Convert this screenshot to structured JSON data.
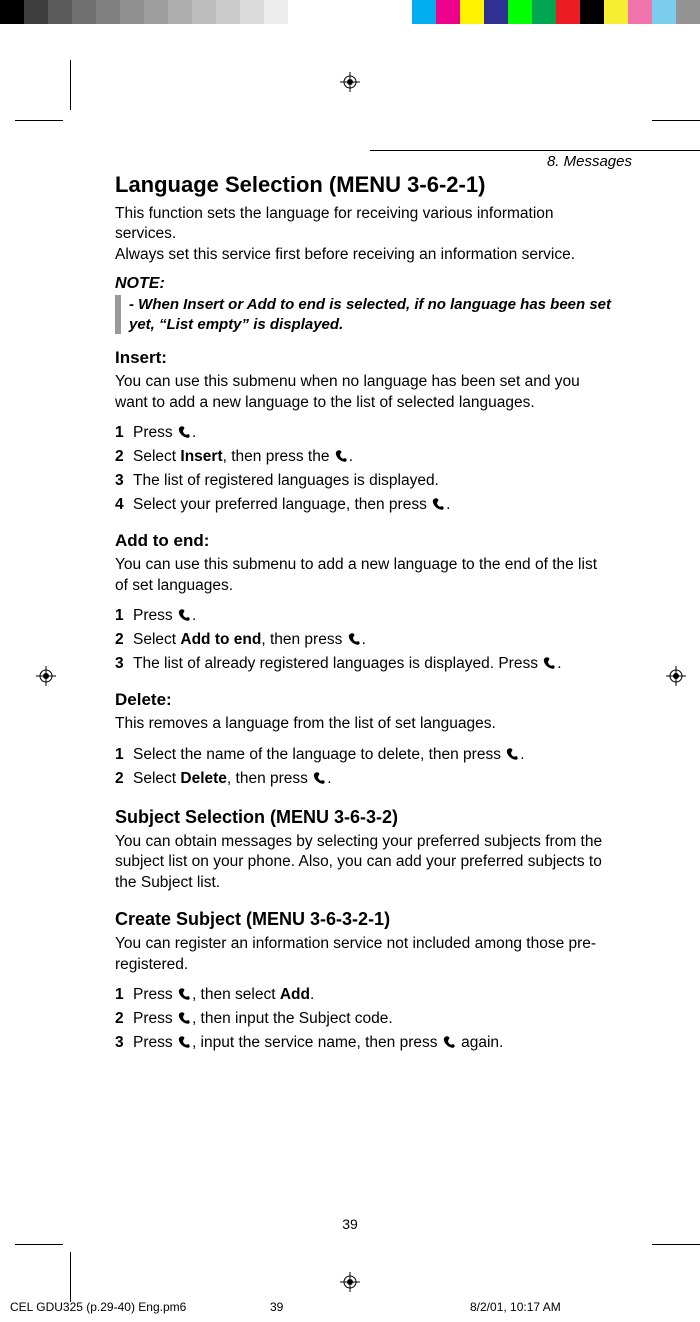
{
  "section": "8. Messages",
  "h1": "Language Selection (MENU 3-6-2-1)",
  "p1": "This function sets the language for receiving various information services.",
  "p1b": "Always set this service first before receiving an information service.",
  "note_label": "NOTE:",
  "note_body": "- When Insert or Add to end is selected, if no language has been set yet, “List empty” is displayed.",
  "insert": {
    "title": "Insert:",
    "desc": "You can use this submenu when no language has been set and you want to add a new language to the list of selected languages.",
    "steps": [
      {
        "n": "1",
        "before": "Press ",
        "after": "."
      },
      {
        "n": "2",
        "before": "Select ",
        "bold": "Insert",
        "mid": ", then press the ",
        "after": "."
      },
      {
        "n": "3",
        "text": "The list of registered languages is displayed."
      },
      {
        "n": "4",
        "before": "Select your preferred language, then press ",
        "after": "."
      }
    ]
  },
  "add": {
    "title": "Add to end:",
    "desc": "You can use this submenu to add a new language to the end of the list of set languages.",
    "steps": [
      {
        "n": "1",
        "before": "Press ",
        "after": "."
      },
      {
        "n": "2",
        "before": "Select ",
        "bold": "Add to end",
        "mid": ", then press ",
        "after": "."
      },
      {
        "n": "3",
        "before": "The list of already registered languages is displayed.  Press ",
        "after": "."
      }
    ]
  },
  "del": {
    "title": "Delete:",
    "desc": "This removes a language from the list of set languages.",
    "steps": [
      {
        "n": "1",
        "before": "Select the name of the language to delete, then press ",
        "after": "."
      },
      {
        "n": "2",
        "before": "Select ",
        "bold": "Delete",
        "mid": ", then press ",
        "after": "."
      }
    ]
  },
  "h2": "Subject Selection (MENU 3-6-3-2)",
  "p2": "You can obtain messages by selecting your preferred subjects from the subject list on your phone.  Also, you can add your preferred subjects to the Subject list.",
  "h3": "Create Subject (MENU 3-6-3-2-1)",
  "p3": "You can register an information service not included among those pre-registered.",
  "create_steps": [
    {
      "n": "1",
      "before": "Press ",
      "mid": ", then select ",
      "bold": "Add",
      "after": "."
    },
    {
      "n": "2",
      "before": "Press ",
      "mid": ", then input the Subject code."
    },
    {
      "n": "3",
      "before": "Press ",
      "mid": ", input the service name, then press ",
      "after2": " again."
    }
  ],
  "page_num": "39",
  "footer": {
    "file": "CEL GDU325 (p.29-40) Eng.pm6",
    "page": "39",
    "date": "8/2/01, 10:17 AM"
  },
  "swatches_left": [
    "#000000",
    "#3d3d3d",
    "#5c5c5c",
    "#707070",
    "#808080",
    "#8f8f8f",
    "#9e9e9e",
    "#adadad",
    "#bdbdbd",
    "#cccccc",
    "#dbdbdb",
    "#ededed",
    "#ffffff"
  ],
  "swatches_right": [
    "#00aeef",
    "#ec008c",
    "#fff200",
    "#2e3192",
    "#00ff00",
    "#00a651",
    "#ed1c24",
    "#000000",
    "#f5ee31",
    "#f173ac",
    "#7bcdee",
    "#949494"
  ]
}
